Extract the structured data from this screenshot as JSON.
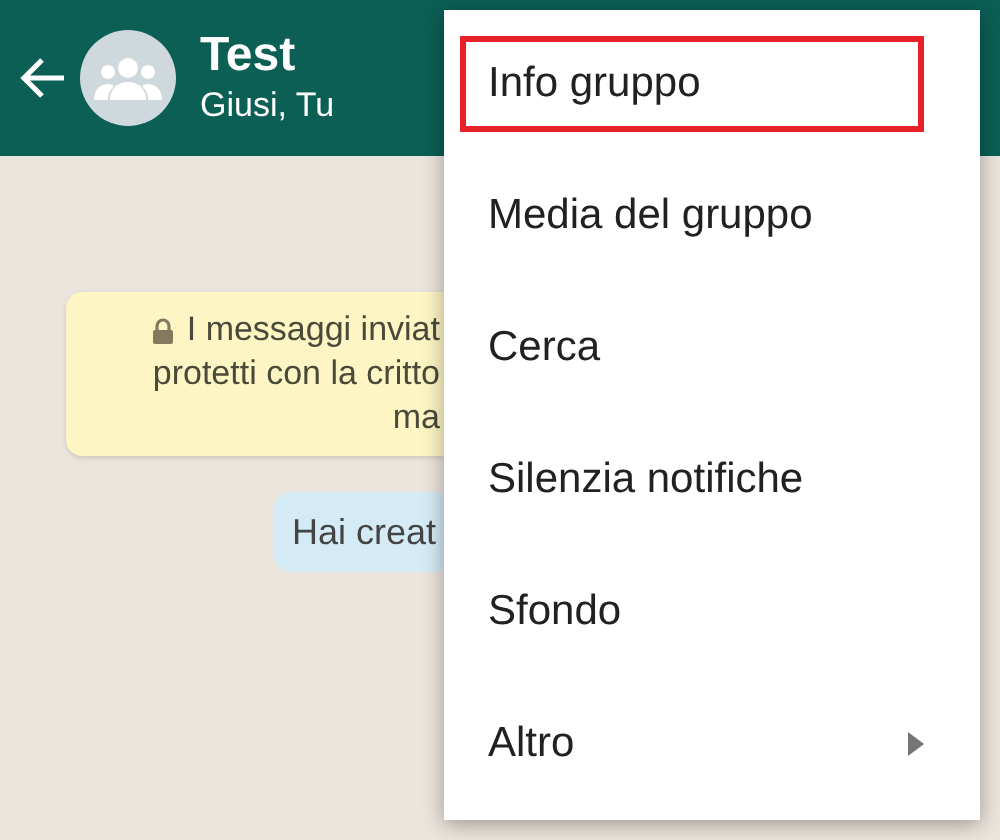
{
  "header": {
    "title": "Test",
    "subtitle": "Giusi, Tu"
  },
  "chat": {
    "system_lines": [
      "I messaggi inviat",
      "protetti con la critto",
      "ma"
    ],
    "message": "Hai creat"
  },
  "menu": [
    {
      "label": "Info gruppo",
      "kind": "plain",
      "highlighted": true
    },
    {
      "label": "Media del gruppo",
      "kind": "plain",
      "highlighted": false
    },
    {
      "label": "Cerca",
      "kind": "plain",
      "highlighted": false
    },
    {
      "label": "Silenzia notifiche",
      "kind": "plain",
      "highlighted": false
    },
    {
      "label": "Sfondo",
      "kind": "plain",
      "highlighted": false
    },
    {
      "label": "Altro",
      "kind": "submenu",
      "highlighted": false
    }
  ]
}
